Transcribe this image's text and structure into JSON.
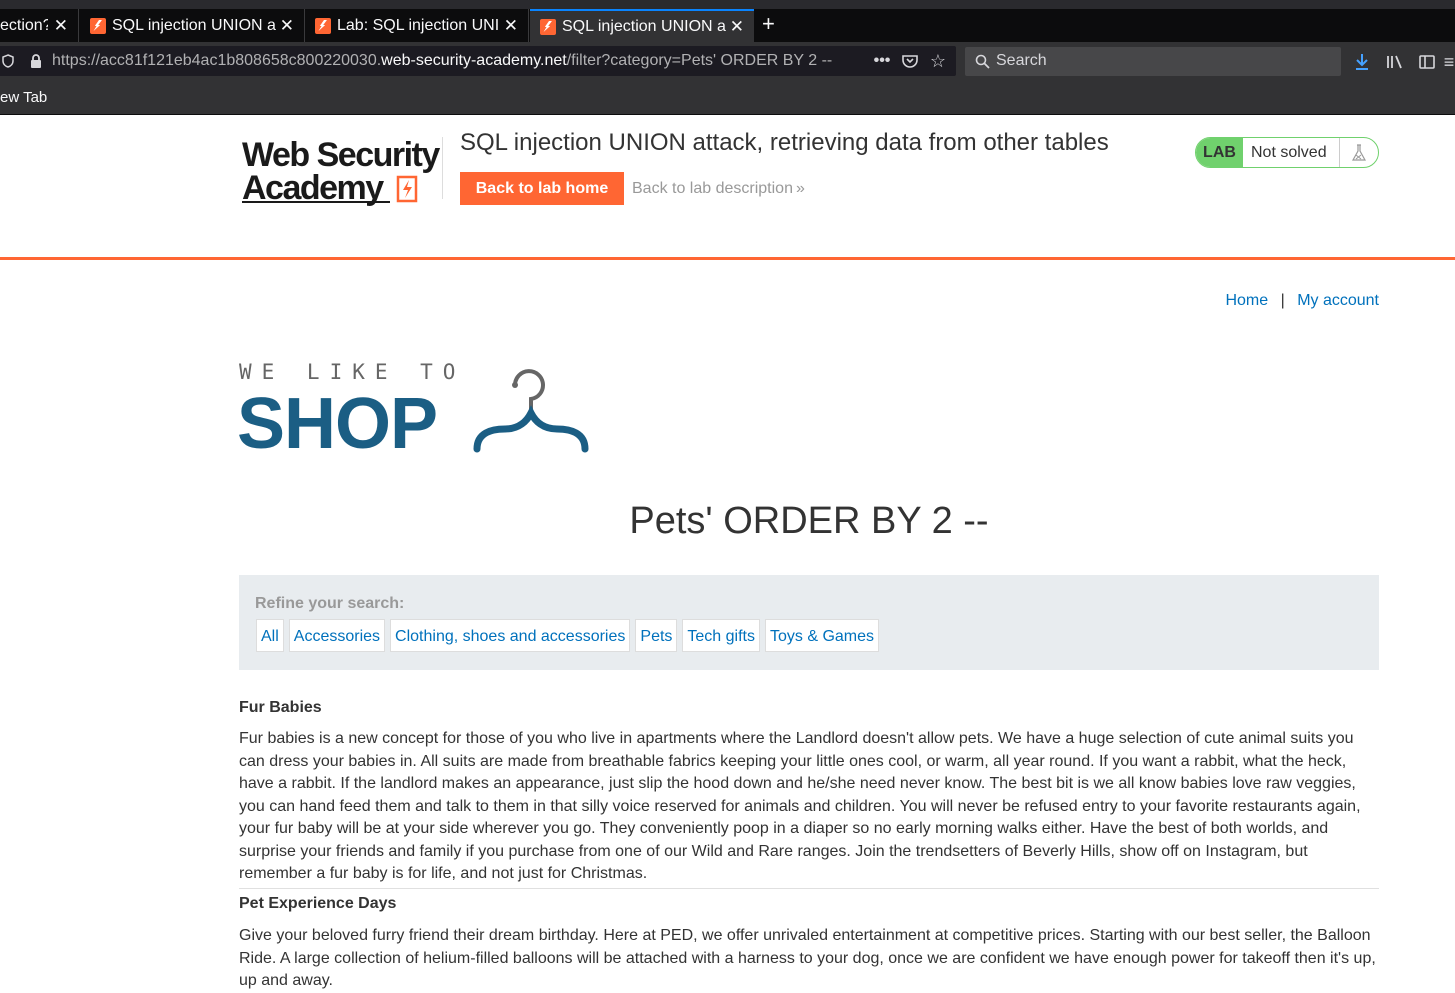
{
  "browser": {
    "tabs": [
      {
        "title": "ection?",
        "active": false
      },
      {
        "title": "SQL injection UNION a",
        "active": false
      },
      {
        "title": "Lab: SQL injection UNI",
        "active": false
      },
      {
        "title": "SQL injection UNION a",
        "active": true
      }
    ],
    "url_prefix": "https://acc81f121eb4ac1b808658c800220030.",
    "url_host": "web-security-academy.net",
    "url_path": "/filter?category=Pets' ORDER BY 2 --",
    "search_placeholder": "Search",
    "bookmark": "ew Tab"
  },
  "lab": {
    "logo_line1": "Web Security",
    "logo_line2": "Academy",
    "title": "SQL injection UNION attack, retrieving data from other tables",
    "home_button": "Back to lab home",
    "desc_link": "Back to lab description",
    "badge": "LAB",
    "status": "Not solved"
  },
  "nav": {
    "home": "Home",
    "separator": "|",
    "account": "My account"
  },
  "shop": {
    "tagline": "WE LIKE TO",
    "word": "SHOP"
  },
  "heading": "Pets' ORDER BY 2 --",
  "refine": {
    "label": "Refine your search:",
    "filters": [
      "All",
      "Accessories",
      "Clothing, shoes and accessories",
      "Pets",
      "Tech gifts",
      "Toys & Games"
    ]
  },
  "articles": [
    {
      "title": "Fur Babies",
      "body": "Fur babies is a new concept for those of you who live in apartments where the Landlord doesn't allow pets. We have a huge selection of cute animal suits you can dress your babies in. All suits are made from breathable fabrics keeping your little ones cool, or warm, all year round. If you want a rabbit, what the heck, have a rabbit. If the landlord makes an appearance, just slip the hood down and he/she need never know. The best bit is we all know babies love raw veggies, you can hand feed them and talk to them in that silly voice reserved for animals and children. You will never be refused entry to your favorite restaurants again, your fur baby will be at your side wherever you go. They conveniently poop in a diaper so no early morning walks either. Have the best of both worlds, and surprise your friends and family if you purchase from one of our Wild and Rare ranges. Join the trendsetters of Beverly Hills, show off on Instagram, but remember a fur baby is for life, and not just for Christmas."
    },
    {
      "title": "Pet Experience Days",
      "body": "Give your beloved furry friend their dream birthday. Here at PED, we offer unrivaled entertainment at competitive prices. Starting with our best seller, the Balloon Ride. A large collection of helium-filled balloons will be attached with a harness to your dog, once we are confident we have enough power for takeoff then it's up, up and away."
    }
  ]
}
